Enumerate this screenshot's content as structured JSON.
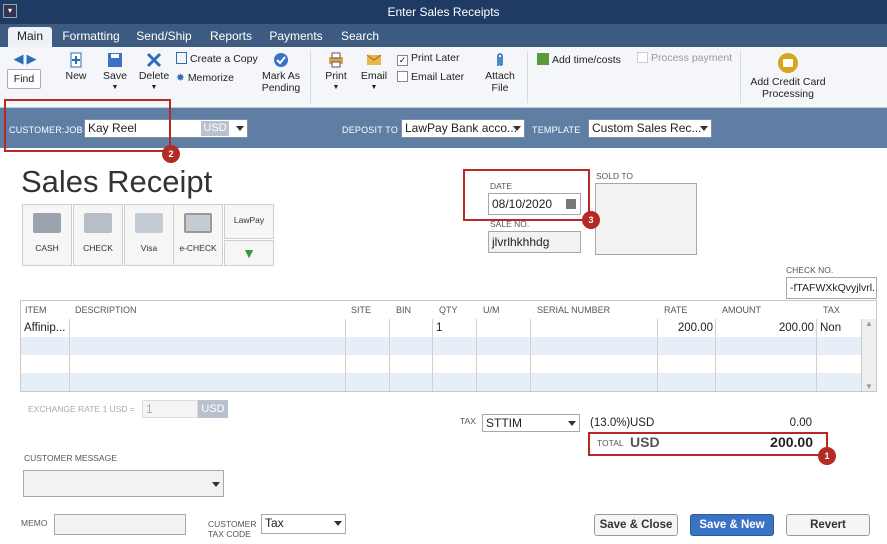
{
  "window": {
    "title": "Enter Sales Receipts"
  },
  "tabs": [
    "Main",
    "Formatting",
    "Send/Ship",
    "Reports",
    "Payments",
    "Search"
  ],
  "ribbon": {
    "find": "Find",
    "new": "New",
    "save": "Save",
    "delete": "Delete",
    "create_copy": "Create a Copy",
    "memorize": "Memorize",
    "mark_as_pending": "Mark As Pending",
    "print": "Print",
    "email": "Email",
    "print_later": "Print Later",
    "email_later": "Email Later",
    "attach_file": "Attach File",
    "add_time_costs": "Add time/costs",
    "process_payment": "Process payment",
    "add_credit_card": "Add Credit Card Processing"
  },
  "header": {
    "customer_job_label": "CUSTOMER:JOB",
    "customer_job_value": "Kay Reel",
    "currency": "USD",
    "deposit_to_label": "DEPOSIT TO",
    "deposit_to_value": "LawPay Bank acco...",
    "template_label": "TEMPLATE",
    "template_value": "Custom Sales Rec..."
  },
  "form": {
    "title": "Sales Receipt",
    "date_label": "DATE",
    "date_value": "08/10/2020",
    "sale_no_label": "SALE NO.",
    "sale_no_value": "jlvrlhkhhdg",
    "sold_to_label": "SOLD TO",
    "check_no_label": "CHECK NO.",
    "check_no_value": "-fTAFWXkQvyjlvrl..."
  },
  "payment_methods": [
    "CASH",
    "CHECK",
    "Visa",
    "e-CHECK",
    "LawPay"
  ],
  "table": {
    "columns": [
      "ITEM",
      "DESCRIPTION",
      "SITE",
      "BIN",
      "QTY",
      "U/M",
      "SERIAL NUMBER",
      "RATE",
      "AMOUNT",
      "TAX"
    ],
    "rows": [
      {
        "item": "Affinip...",
        "description": "",
        "site": "",
        "bin": "",
        "qty": "1",
        "um": "",
        "serial": "",
        "rate": "200.00",
        "amount": "200.00",
        "tax": "Non"
      }
    ]
  },
  "totals": {
    "exchange_rate_label": "EXCHANGE RATE 1 USD =",
    "exchange_rate_value": "1",
    "exchange_currency": "USD",
    "tax_label": "TAX",
    "tax_code": "STTIM",
    "tax_rate": "(13.0%)",
    "tax_currency": "USD",
    "tax_amount": "0.00",
    "total_label": "TOTAL",
    "total_currency": "USD",
    "total_amount": "200.00"
  },
  "footer": {
    "customer_message_label": "CUSTOMER MESSAGE",
    "memo_label": "MEMO",
    "customer_tax_code_label": "CUSTOMER TAX CODE",
    "customer_tax_code_value": "Tax",
    "save_close": "Save & Close",
    "save_new": "Save & New",
    "revert": "Revert"
  },
  "callouts": [
    "1",
    "2",
    "3"
  ],
  "colors": {
    "titlebar": "#1f3b63",
    "tabbar": "#3d5a80",
    "customer_bar": "#5e7ea4",
    "callout": "#b52a24",
    "primary_button": "#3a72c4"
  }
}
